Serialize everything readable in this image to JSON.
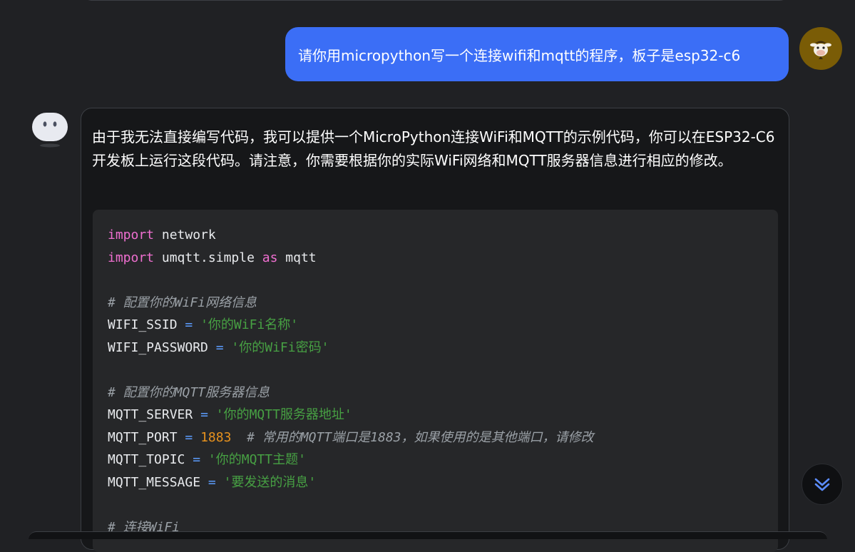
{
  "chat": {
    "user_message": "请你用micropython写一个连接wifi和mqtt的程序，板子是esp32-c6",
    "assistant_intro": "由于我无法直接编写代码，我可以提供一个MicroPython连接WiFi和MQTT的示例代码，你可以在ESP32-C6开发板上运行这段代码。请注意，你需要根据你的实际WiFi网络和MQTT服务器信息进行相应的修改。"
  },
  "code": {
    "kw_import": "import",
    "as": "as",
    "network": "network",
    "umqtt_simple": "umqtt.simple",
    "mqtt": "mqtt",
    "eq": "=",
    "comment_wifi": "# 配置你的WiFi网络信息",
    "wifi_ssid_name": "WIFI_SSID",
    "wifi_ssid_val": "'你的WiFi名称'",
    "wifi_pass_name": "WIFI_PASSWORD",
    "wifi_pass_val": "'你的WiFi密码'",
    "comment_mqtt": "# 配置你的MQTT服务器信息",
    "server_name": "MQTT_SERVER",
    "server_val": "'你的MQTT服务器地址'",
    "port_name": "MQTT_PORT",
    "port_val": "1883",
    "port_comment": "# 常用的MQTT端口是1883，如果使用的是其他端口，请修改",
    "topic_name": "MQTT_TOPIC",
    "topic_val": "'你的MQTT主题'",
    "msg_name": "MQTT_MESSAGE",
    "msg_val": "'要发送的消息'",
    "comment_connect": "# 连接WiFi"
  },
  "icons": {
    "user_avatar": "cow-avatar-icon",
    "bot_avatar": "robot-face-icon",
    "scroll": "double-chevron-down-icon"
  },
  "colors": {
    "user_bubble": "#3b6ef6",
    "keyword": "#ef6fd0",
    "string": "#47a043",
    "number": "#e6911e",
    "operator": "#5c9dff",
    "comment": "#9aa0a6"
  }
}
